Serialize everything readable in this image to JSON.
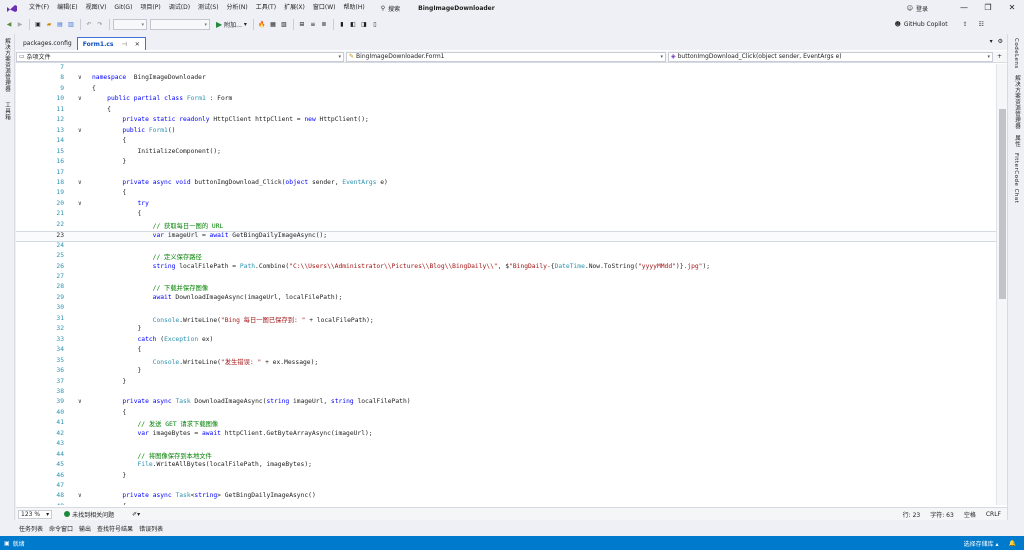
{
  "menubar": {
    "logo": "vs-logo-icon",
    "items": [
      "文件(F)",
      "编辑(E)",
      "视图(V)",
      "Git(G)",
      "项目(P)",
      "调试(D)",
      "测试(S)",
      "分析(N)",
      "工具(T)",
      "扩展(X)",
      "窗口(W)",
      "帮助(H)"
    ],
    "search": "搜索",
    "title": "BingImageDownloader",
    "login": "登录"
  },
  "toolbar": {
    "run_label": "附加...",
    "copilot": "GitHub Copilot"
  },
  "left_strip": [
    "解决方案资源管理器",
    "工具箱"
  ],
  "right_strip": [
    "CodeLens",
    "解决方案资源管理器",
    "属性",
    "FitterCode Chat"
  ],
  "tabs": [
    {
      "label": "packages.config",
      "active": false
    },
    {
      "label": "Form1.cs",
      "active": true
    }
  ],
  "navbar": {
    "project": "杂项文件",
    "class": "BingImageDownloader.Form1",
    "member": "buttonImgDownload_Click(object sender, EventArgs e)"
  },
  "code": {
    "current_line": 23,
    "lines": [
      {
        "n": 7,
        "fold": "",
        "t": []
      },
      {
        "n": 8,
        "fold": "∨",
        "t": [
          [
            "kw",
            "namespace"
          ],
          [
            "",
            "  BingImageDownloader"
          ]
        ]
      },
      {
        "n": 9,
        "fold": "",
        "t": [
          [
            "",
            "{"
          ]
        ]
      },
      {
        "n": 10,
        "fold": "∨",
        "t": [
          [
            "",
            "    "
          ],
          [
            "kw",
            "public"
          ],
          [
            "",
            " "
          ],
          [
            "kw",
            "partial"
          ],
          [
            "",
            " "
          ],
          [
            "kw",
            "class"
          ],
          [
            "",
            " "
          ],
          [
            "ty",
            "Form1"
          ],
          [
            "",
            " : Form"
          ]
        ]
      },
      {
        "n": 11,
        "fold": "",
        "t": [
          [
            "",
            "    {"
          ]
        ]
      },
      {
        "n": 12,
        "fold": "",
        "t": [
          [
            "",
            "        "
          ],
          [
            "kw",
            "private"
          ],
          [
            "",
            " "
          ],
          [
            "kw",
            "static"
          ],
          [
            "",
            " "
          ],
          [
            "kw",
            "readonly"
          ],
          [
            "",
            " HttpClient httpClient = "
          ],
          [
            "kw",
            "new"
          ],
          [
            "",
            " HttpClient();"
          ]
        ]
      },
      {
        "n": 13,
        "fold": "∨",
        "t": [
          [
            "",
            "        "
          ],
          [
            "kw",
            "public"
          ],
          [
            "",
            " "
          ],
          [
            "ty",
            "Form1"
          ],
          [
            "",
            "()"
          ]
        ]
      },
      {
        "n": 14,
        "fold": "",
        "t": [
          [
            "",
            "        {"
          ]
        ]
      },
      {
        "n": 15,
        "fold": "",
        "t": [
          [
            "",
            "            InitializeComponent();"
          ]
        ]
      },
      {
        "n": 16,
        "fold": "",
        "t": [
          [
            "",
            "        }"
          ]
        ]
      },
      {
        "n": 17,
        "fold": "",
        "t": []
      },
      {
        "n": 18,
        "fold": "∨",
        "t": [
          [
            "",
            "        "
          ],
          [
            "kw",
            "private"
          ],
          [
            "",
            " "
          ],
          [
            "kw",
            "async"
          ],
          [
            "",
            " "
          ],
          [
            "kw",
            "void"
          ],
          [
            "",
            " buttonImgDownload_Click("
          ],
          [
            "kw",
            "object"
          ],
          [
            "",
            " sender, "
          ],
          [
            "ty",
            "EventArgs"
          ],
          [
            "",
            " e)"
          ]
        ]
      },
      {
        "n": 19,
        "fold": "",
        "t": [
          [
            "",
            "        {"
          ]
        ]
      },
      {
        "n": 20,
        "fold": "∨",
        "t": [
          [
            "",
            "            "
          ],
          [
            "kw",
            "try"
          ]
        ]
      },
      {
        "n": 21,
        "fold": "",
        "t": [
          [
            "",
            "            {"
          ]
        ]
      },
      {
        "n": 22,
        "fold": "",
        "t": [
          [
            "",
            "                "
          ],
          [
            "cm",
            "// 获取每日一图的 URL"
          ]
        ]
      },
      {
        "n": 23,
        "fold": "",
        "t": [
          [
            "",
            "                "
          ],
          [
            "kw",
            "var"
          ],
          [
            "",
            " imageUrl = "
          ],
          [
            "kw",
            "await"
          ],
          [
            "",
            " GetBingDailyImageAsync();"
          ]
        ]
      },
      {
        "n": 24,
        "fold": "",
        "t": []
      },
      {
        "n": 25,
        "fold": "",
        "t": [
          [
            "",
            "                "
          ],
          [
            "cm",
            "// 定义保存路径"
          ]
        ]
      },
      {
        "n": 26,
        "fold": "",
        "t": [
          [
            "",
            "                "
          ],
          [
            "kw",
            "string"
          ],
          [
            "",
            " localFilePath = "
          ],
          [
            "ty",
            "Path"
          ],
          [
            "",
            ".Combine("
          ],
          [
            "st",
            "\"C:\\\\Users\\\\Administrator\\\\Pictures\\\\Blog\\\\BingDaily\\\\\""
          ],
          [
            "",
            ", $"
          ],
          [
            "st",
            "\"BingDaily-"
          ],
          [
            "",
            "{"
          ],
          [
            "ty",
            "DateTime"
          ],
          [
            "",
            ".Now.ToString("
          ],
          [
            "st",
            "\"yyyyMMdd\""
          ],
          [
            "",
            ")}"
          ],
          [
            "st",
            ".jpg\""
          ],
          [
            "",
            ");"
          ]
        ]
      },
      {
        "n": 27,
        "fold": "",
        "t": []
      },
      {
        "n": 28,
        "fold": "",
        "t": [
          [
            "",
            "                "
          ],
          [
            "cm",
            "// 下载并保存图像"
          ]
        ]
      },
      {
        "n": 29,
        "fold": "",
        "t": [
          [
            "",
            "                "
          ],
          [
            "kw",
            "await"
          ],
          [
            "",
            " DownloadImageAsync(imageUrl, localFilePath);"
          ]
        ]
      },
      {
        "n": 30,
        "fold": "",
        "t": []
      },
      {
        "n": 31,
        "fold": "",
        "t": [
          [
            "",
            "                "
          ],
          [
            "ty",
            "Console"
          ],
          [
            "",
            ".WriteLine("
          ],
          [
            "st",
            "\"Bing 每日一图已保存到: \""
          ],
          [
            "",
            " + localFilePath);"
          ]
        ]
      },
      {
        "n": 32,
        "fold": "",
        "t": [
          [
            "",
            "            }"
          ]
        ]
      },
      {
        "n": 33,
        "fold": "",
        "t": [
          [
            "",
            "            "
          ],
          [
            "kw",
            "catch"
          ],
          [
            "",
            " ("
          ],
          [
            "ty",
            "Exception"
          ],
          [
            "",
            " ex)"
          ]
        ]
      },
      {
        "n": 34,
        "fold": "",
        "t": [
          [
            "",
            "            {"
          ]
        ]
      },
      {
        "n": 35,
        "fold": "",
        "t": [
          [
            "",
            "                "
          ],
          [
            "ty",
            "Console"
          ],
          [
            "",
            ".WriteLine("
          ],
          [
            "st",
            "\"发生错误: \""
          ],
          [
            "",
            " + ex.Message);"
          ]
        ]
      },
      {
        "n": 36,
        "fold": "",
        "t": [
          [
            "",
            "            }"
          ]
        ]
      },
      {
        "n": 37,
        "fold": "",
        "t": [
          [
            "",
            "        }"
          ]
        ]
      },
      {
        "n": 38,
        "fold": "",
        "t": []
      },
      {
        "n": 39,
        "fold": "∨",
        "t": [
          [
            "",
            "        "
          ],
          [
            "kw",
            "private"
          ],
          [
            "",
            " "
          ],
          [
            "kw",
            "async"
          ],
          [
            "",
            " "
          ],
          [
            "ty",
            "Task"
          ],
          [
            "",
            " DownloadImageAsync("
          ],
          [
            "kw",
            "string"
          ],
          [
            "",
            " imageUrl, "
          ],
          [
            "kw",
            "string"
          ],
          [
            "",
            " localFilePath)"
          ]
        ]
      },
      {
        "n": 40,
        "fold": "",
        "t": [
          [
            "",
            "        {"
          ]
        ]
      },
      {
        "n": 41,
        "fold": "",
        "t": [
          [
            "",
            "            "
          ],
          [
            "cm",
            "// 发送 GET 请求下载图像"
          ]
        ]
      },
      {
        "n": 42,
        "fold": "",
        "t": [
          [
            "",
            "            "
          ],
          [
            "kw",
            "var"
          ],
          [
            "",
            " imageBytes = "
          ],
          [
            "kw",
            "await"
          ],
          [
            "",
            " httpClient.GetByteArrayAsync(imageUrl);"
          ]
        ]
      },
      {
        "n": 43,
        "fold": "",
        "t": []
      },
      {
        "n": 44,
        "fold": "",
        "t": [
          [
            "",
            "            "
          ],
          [
            "cm",
            "// 将图像保存到本地文件"
          ]
        ]
      },
      {
        "n": 45,
        "fold": "",
        "t": [
          [
            "",
            "            "
          ],
          [
            "ty",
            "File"
          ],
          [
            "",
            ".WriteAllBytes(localFilePath, imageBytes);"
          ]
        ]
      },
      {
        "n": 46,
        "fold": "",
        "t": [
          [
            "",
            "        }"
          ]
        ]
      },
      {
        "n": 47,
        "fold": "",
        "t": []
      },
      {
        "n": 48,
        "fold": "∨",
        "t": [
          [
            "",
            "        "
          ],
          [
            "kw",
            "private"
          ],
          [
            "",
            " "
          ],
          [
            "kw",
            "async"
          ],
          [
            "",
            " "
          ],
          [
            "ty",
            "Task"
          ],
          [
            "",
            "<"
          ],
          [
            "kw",
            "string"
          ],
          [
            "",
            "> GetBingDailyImageAsync()"
          ]
        ]
      },
      {
        "n": 49,
        "fold": "",
        "t": [
          [
            "",
            "        {"
          ]
        ]
      }
    ]
  },
  "hintbar": {
    "zoom": "123 %",
    "issues": "未找到相关问题",
    "line": "行: 23",
    "char": "字符: 63",
    "mode": "空格",
    "eol": "CRLF"
  },
  "bottom_tabs": [
    "任务列表",
    "命令窗口",
    "输出",
    "查找符号结果",
    "错误列表"
  ],
  "status": {
    "left": "就绪",
    "repo": "选择存储库"
  },
  "colors": {
    "status_bar": "#007acc",
    "keyword": "#0000ff",
    "type": "#2b91af",
    "string": "#a31515",
    "comment": "#008000"
  }
}
